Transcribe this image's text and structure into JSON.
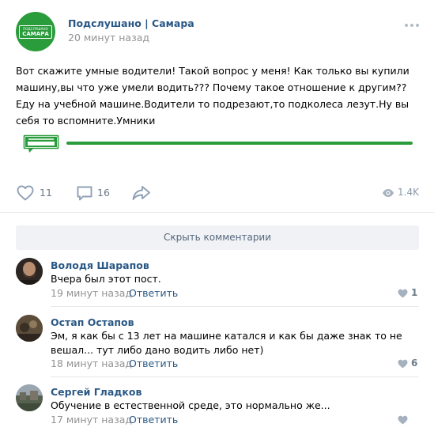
{
  "post": {
    "group_name": "Подслушано | Самара",
    "time": "20 минут назад",
    "logo_small": "ПОДСЛУШАНО",
    "logo_big": "САМАРА",
    "text": "Вот скажите умные водители! Такой вопрос у меня! Как только вы купили машину,вы что уже умели водить??? Почему такое отношение к другим?? Еду на учебной машине.Водители то подрезают,то подколеса лезут.Ну вы себя то вспомните.Умники",
    "likes": "11",
    "comments_count": "16",
    "views": "1.4K",
    "accent_color": "#2a9c3c",
    "icons": [
      "heart-icon",
      "comment-icon",
      "share-icon",
      "eye-icon",
      "more-icon"
    ]
  },
  "comments_section": {
    "hide_label": "Скрыть комментарии",
    "reply_label": "Ответить",
    "items": [
      {
        "author": "Володя Шарапов",
        "text": "Вчера был этот пост.",
        "time": "19 минут назад",
        "likes": "1"
      },
      {
        "author": "Остап Остапов",
        "text": "Эм, я как бы с 13 лет на машине катался и как бы даже знак то не вешал... тут либо дано водить либо нет)",
        "time": "18 минут назад",
        "likes": "6"
      },
      {
        "author": "Сергей Гладков",
        "text": "Обучение в естественной среде, это нормально же...",
        "time": "17 минут назад",
        "likes": ""
      }
    ]
  }
}
